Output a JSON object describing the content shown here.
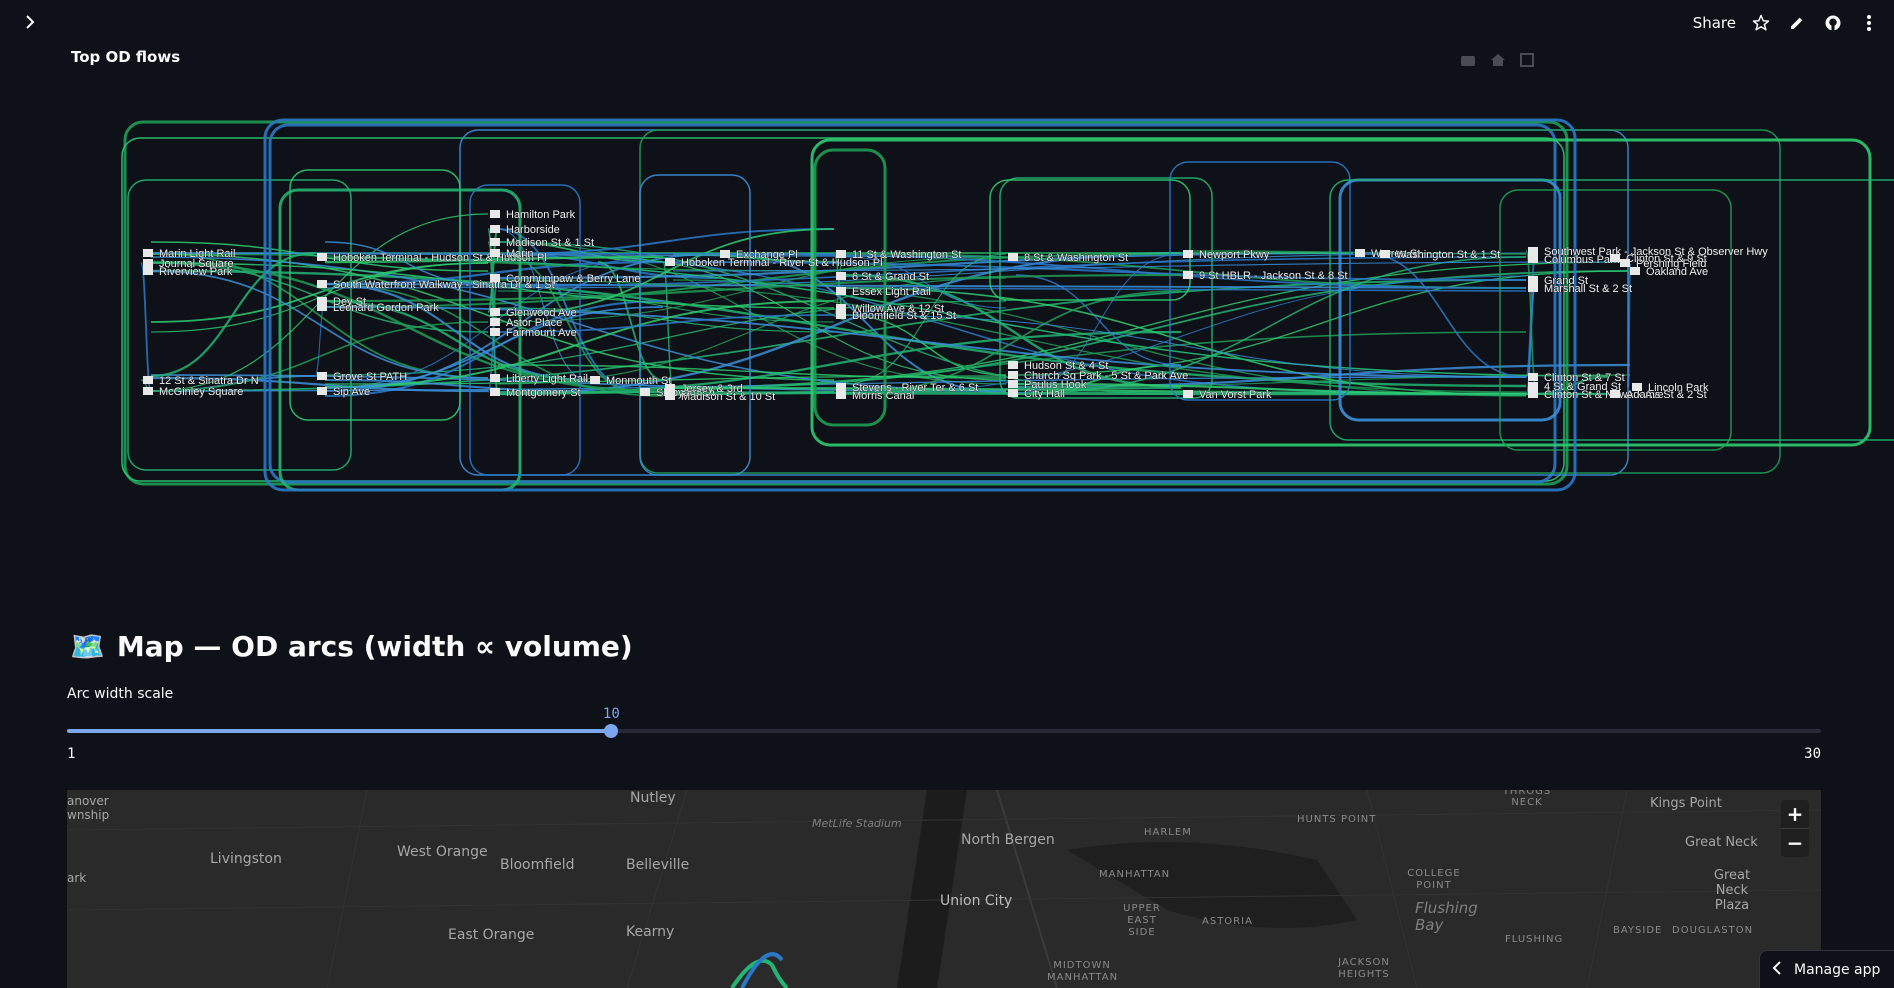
{
  "header": {
    "share_label": "Share",
    "icons": [
      "sidebar-toggle-icon",
      "star-icon",
      "pencil-icon",
      "github-icon",
      "more-vertical-icon"
    ]
  },
  "chart_title": "Top OD flows",
  "chart_data": {
    "type": "sankey",
    "title": "Top OD flows",
    "link_colors": [
      "#1f9e57",
      "#2ecc71",
      "#22b573",
      "#2a79c9",
      "#3b8fd9"
    ],
    "node_labels": [
      "Marin Light Rail",
      "Journal Square",
      "Riverview Park",
      "12 St & Sinatra Dr N",
      "McGinley Square",
      "Hoboken Terminal - Hudson St & Hudson Pl",
      "South Waterfront Walkway - Sinatra Dr & 1 St",
      "Dey St",
      "Leonard Gordon Park",
      "Grove St PATH",
      "Sip Ave",
      "Hamilton Park",
      "Harborside",
      "Madison St & 1 St",
      "Marin",
      "Communipaw & Berry Lane",
      "Glenwood Ave",
      "Astor Place",
      "Fairmount Ave",
      "Montgomery St",
      "Liberty Light Rail",
      "Monmouth St",
      "Shipyard Ln",
      "Exchange Pl",
      "Hoboken Terminal - River St & Hudson Pl",
      "Jersey & 3rd",
      "Madison St & 10 St",
      "11 St & Washington St",
      "6 St & Grand St",
      "Essex Light Rail",
      "Willow Ave & 12 St",
      "Bloomfield St & 15 St",
      "Stevens - River Ter & 6 St",
      "Morris Canal",
      "8 St & Washington St",
      "Hudson St & 4 St",
      "Church Sq Park - 5 St & Park Ave",
      "Paulus Hook",
      "City Hall",
      "Newport Pkwy",
      "9 St HBLR - Jackson St & 8 St",
      "Van Vorst Park",
      "Warren St",
      "Washington St & 1 St",
      "Southwest Park - Jackson St & Observer Hwy",
      "Columbus Park",
      "Clinton St & 9 St",
      "Pershing Field",
      "Oakland Ave",
      "Grand St",
      "Marshall St & 2 St",
      "Clinton St & 7 St",
      "4 St & Grand St",
      "Clinton St & Newark Ave",
      "Adams St & 2 St",
      "Lincoln Park"
    ]
  },
  "map_section": {
    "emoji": "🗺️",
    "title": "Map — OD arcs (width ∝ volume)",
    "slider": {
      "label": "Arc width scale",
      "min": 1,
      "max": 30,
      "value": 10
    },
    "labels": [
      "Nutley",
      "Livingston",
      "West Orange",
      "Bloomfield",
      "Belleville",
      "MetLife Stadium",
      "North Bergen",
      "Union City",
      "East Orange",
      "Kearny",
      "HARLEM",
      "MANHATTAN",
      "UPPER EAST SIDE",
      "ASTORIA",
      "MIDTOWN MANHATTAN",
      "HUNTS POINT",
      "COLLEGE POINT",
      "Flushing Bay",
      "FLUSHING",
      "JACKSON HEIGHTS",
      "BAYSIDE",
      "DOUGLASTON",
      "Kings Point",
      "Great Neck",
      "Great Neck Plaza",
      "THROGS NECK",
      "anover",
      "wnship",
      "ark"
    ],
    "zoom_in": "+",
    "zoom_out": "−"
  },
  "manage_app": {
    "label": "Manage app"
  }
}
